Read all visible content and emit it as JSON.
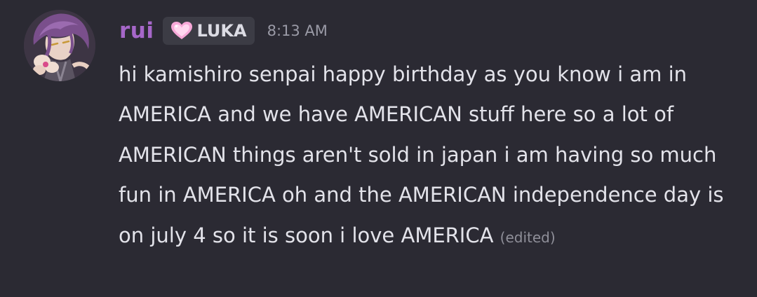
{
  "message": {
    "author": "rui",
    "role_tag": {
      "icon": "pink-heart-icon",
      "label": "LUKA"
    },
    "timestamp": "8:13 AM",
    "text": "hi kamishiro senpai happy birthday as you know i am in AMERICA and we have AMERICAN stuff here so a lot of AMERICAN things aren't sold in japan i am having so much fun in AMERICA oh and the AMERICAN independence day is on july 4 so it is soon i love AMERICA",
    "edited_label": "(edited)"
  },
  "colors": {
    "background": "#2b2a33",
    "username": "#a667c9",
    "tag_background": "#3c3c45",
    "tag_heart": "#f7a8d8",
    "text": "#e3e3ea",
    "muted": "#9a9aa6"
  }
}
